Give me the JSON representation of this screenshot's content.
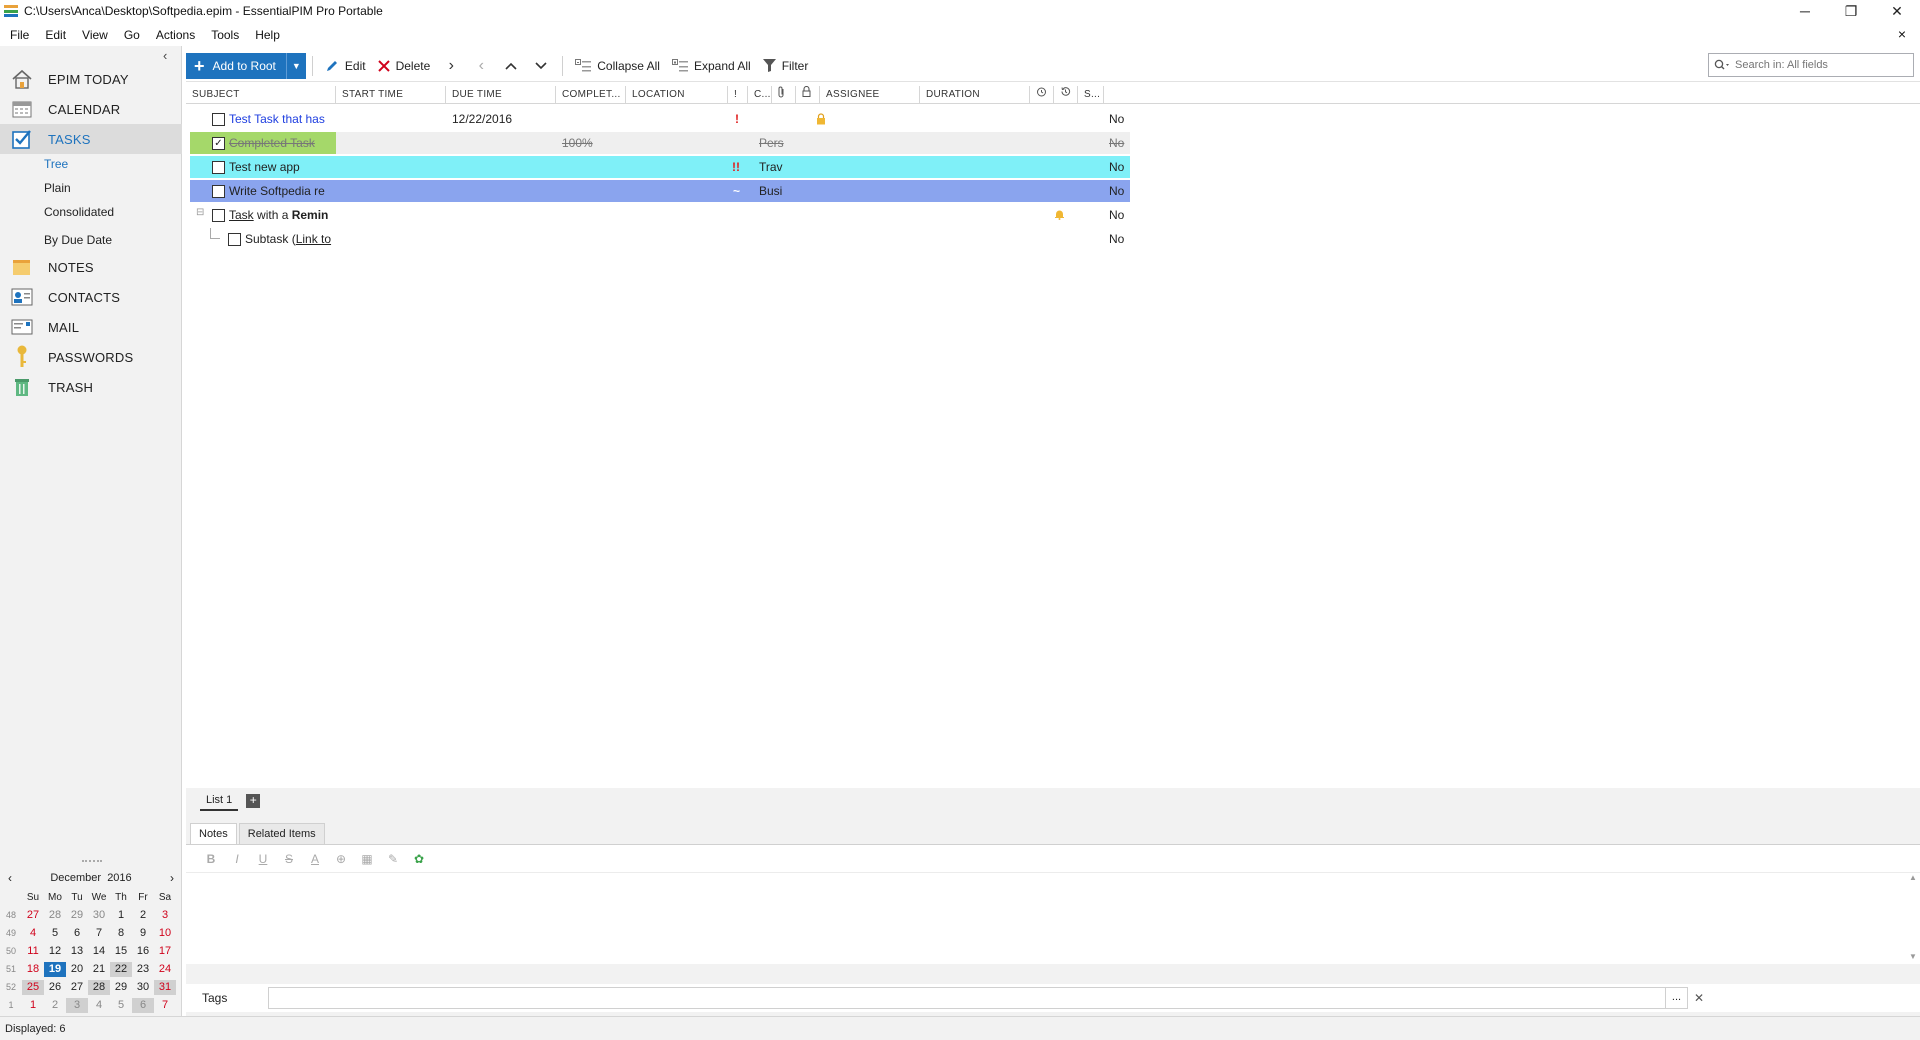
{
  "window": {
    "title": "C:\\Users\\Anca\\Desktop\\Softpedia.epim - EssentialPIM Pro Portable",
    "minimize": "─",
    "restore": "❐",
    "close": "✕"
  },
  "menu": [
    "File",
    "Edit",
    "View",
    "Go",
    "Actions",
    "Tools",
    "Help"
  ],
  "menu_close": "×",
  "sidebar": {
    "collapse": "‹",
    "items": [
      {
        "label": "EPIM TODAY"
      },
      {
        "label": "CALENDAR"
      },
      {
        "label": "TASKS"
      },
      {
        "label": "NOTES"
      },
      {
        "label": "CONTACTS"
      },
      {
        "label": "MAIL"
      },
      {
        "label": "PASSWORDS"
      },
      {
        "label": "TRASH"
      }
    ],
    "sub_items": [
      "Tree",
      "Plain",
      "Consolidated",
      "By Due Date"
    ]
  },
  "calendar": {
    "month": "December",
    "year": "2016",
    "prev": "‹",
    "next": "›",
    "weekday_headers": [
      "Su",
      "Mo",
      "Tu",
      "We",
      "Th",
      "Fr",
      "Sa"
    ],
    "weeks": [
      {
        "wk": "48",
        "days": [
          "27",
          "28",
          "29",
          "30",
          "1",
          "2",
          "3"
        ]
      },
      {
        "wk": "49",
        "days": [
          "4",
          "5",
          "6",
          "7",
          "8",
          "9",
          "10"
        ]
      },
      {
        "wk": "50",
        "days": [
          "11",
          "12",
          "13",
          "14",
          "15",
          "16",
          "17"
        ]
      },
      {
        "wk": "51",
        "days": [
          "18",
          "19",
          "20",
          "21",
          "22",
          "23",
          "24"
        ]
      },
      {
        "wk": "52",
        "days": [
          "25",
          "26",
          "27",
          "28",
          "29",
          "30",
          "31"
        ]
      },
      {
        "wk": "1",
        "days": [
          "1",
          "2",
          "3",
          "4",
          "5",
          "6",
          "7"
        ]
      }
    ],
    "today": "19"
  },
  "toolbar": {
    "add_label": "Add to Root",
    "edit_label": "Edit",
    "delete_label": "Delete",
    "collapse_label": "Collapse All",
    "expand_label": "Expand All",
    "filter_label": "Filter",
    "search_placeholder": "Search in: All fields"
  },
  "columns": {
    "subject": "SUBJECT",
    "start": "START TIME",
    "due": "DUE TIME",
    "complete": "COMPLET...",
    "location": "LOCATION",
    "priority": "!",
    "category": "C...",
    "assignee": "ASSIGNEE",
    "duration": "DURATION",
    "status": "S..."
  },
  "tasks": [
    {
      "subject": "Test Task that has",
      "due": "12/22/2016",
      "priority": "!",
      "category": "",
      "complete": "",
      "status": "No"
    },
    {
      "subject": "Completed Task",
      "due": "",
      "priority": "",
      "category": "Pers",
      "complete": "100%",
      "status": "No"
    },
    {
      "subject": "Test new app",
      "due": "",
      "priority": "!!",
      "category": "Trav",
      "complete": "",
      "status": "No"
    },
    {
      "subject": "Write Softpedia re",
      "due": "",
      "priority": "~",
      "category": "Busi",
      "complete": "",
      "status": "No"
    },
    {
      "subject_parts": [
        "Task",
        " with a ",
        "Remin"
      ],
      "status": "No"
    },
    {
      "subject_parts": [
        "Subtask (",
        "Link to"
      ],
      "status": "No"
    }
  ],
  "bottom": {
    "list_tab": "List 1",
    "list_add": "+",
    "notes_tab": "Notes",
    "related_tab": "Related Items",
    "format": [
      "B",
      "I",
      "U",
      "S",
      "A"
    ],
    "tags_label": "Tags",
    "tags_browse": "...",
    "tags_clear": "✕"
  },
  "status": "Displayed: 6",
  "colors": {
    "accent": "#1e73be",
    "row_cyan": "#7ff0f8",
    "row_blue": "#8aa4ee",
    "row_green": "#a5d86a",
    "priority_red": "#e02020"
  }
}
